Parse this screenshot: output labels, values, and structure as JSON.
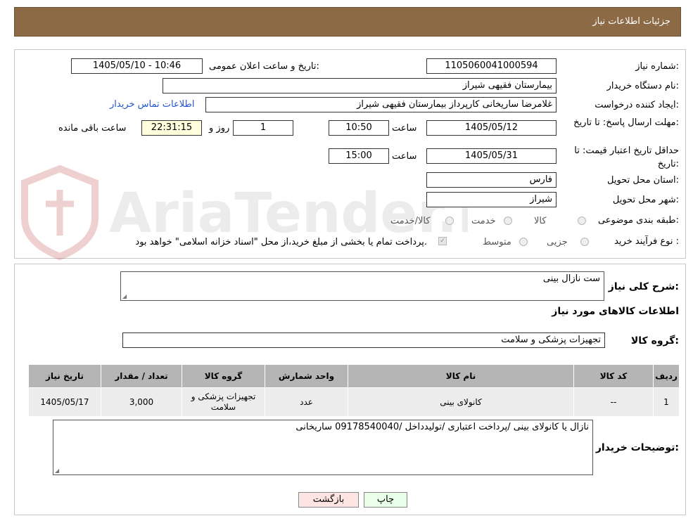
{
  "header": {
    "title": "جزئیات اطلاعات نیاز"
  },
  "watermark_text": "AriaTender.neT",
  "form": {
    "need_number_label": "شماره نیاز:",
    "need_number": "1105060041000594",
    "announce_label": "تاریخ و ساعت اعلان عمومی:",
    "announce_value": "1405/05/10 - 10:46",
    "buyer_org_label": "نام دستگاه خریدار:",
    "buyer_org": "بیمارستان فقیهی شیراز",
    "requester_label": "ایجاد کننده درخواست:",
    "requester": "غلامرضا ساریخانی کارپرداز بیمارستان فقیهی شیراز",
    "contact_link": "اطلاعات تماس خریدار",
    "reply_deadline_label": "مهلت ارسال پاسخ: تا تاریخ:",
    "reply_date": "1405/05/12",
    "time_label": "ساعت",
    "reply_time": "10:50",
    "days_value": "1",
    "days_label": "روز و",
    "remaining_time": "22:31:15",
    "remaining_label": "ساعت باقی مانده",
    "validity_label": "حداقل تاریخ اعتبار قیمت: تا تاریخ:",
    "validity_date": "1405/05/31",
    "validity_time": "15:00",
    "province_label": "استان محل تحویل:",
    "province": "فارس",
    "city_label": "شهر محل تحویل:",
    "city": "شیراز",
    "category_label": "طبقه بندی موضوعی:",
    "category_options": [
      "کالا",
      "خدمت",
      "کالا/خدمت"
    ],
    "process_label": "نوع فرآیند خرید :",
    "process_options": [
      "جزیی",
      "متوسط"
    ],
    "payment_note": "پرداخت تمام یا بخشی از مبلغ خرید،از محل \"اسناد خزانه اسلامی\" خواهد بود."
  },
  "summary": {
    "desc_label": "شرح کلی نیاز:",
    "desc_value": "ست نازال بینی",
    "goods_info_title": "اطلاعات کالاهای مورد نیاز",
    "group_label": "گروه کالا:",
    "group_value": "تجهیزات پزشکی و سلامت",
    "table": {
      "headers": [
        "ردیف",
        "کد کالا",
        "نام کالا",
        "واحد شمارش",
        "گروه کالا",
        "تعداد / مقدار",
        "تاریخ نیاز"
      ],
      "rows": [
        [
          "1",
          "--",
          "کانولای بینی",
          "عدد",
          "تجهیزات پزشکی و سلامت",
          "3,000",
          "1405/05/17"
        ]
      ]
    },
    "buyer_notes_label": "توضیحات خریدار:",
    "buyer_notes": "نازال یا کانولای بینی /پرداخت اعتباری /تولیدداخل /09178540040 ساریخانی"
  },
  "buttons": {
    "print": "چاپ",
    "back": "بازگشت"
  }
}
